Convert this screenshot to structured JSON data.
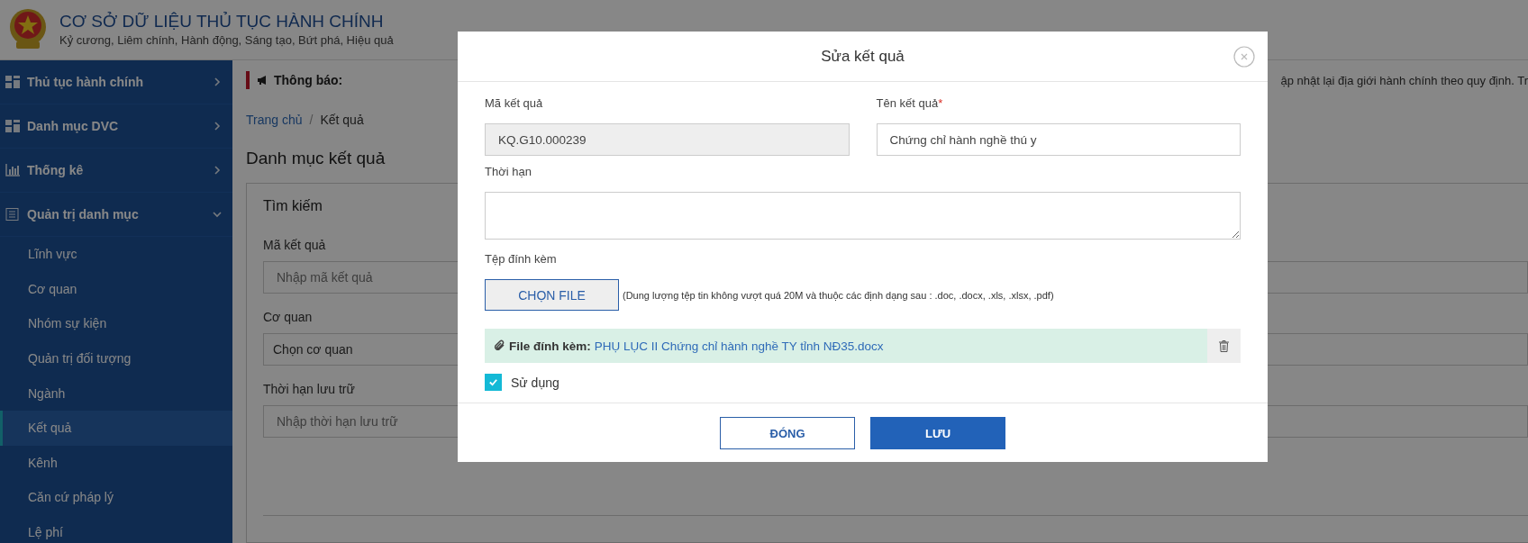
{
  "header": {
    "title": "CƠ SỞ DỮ LIỆU THỦ TỤC HÀNH CHÍNH",
    "slogan": "Kỷ cương, Liêm chính, Hành động, Sáng tạo, Bứt phá, Hiệu quả"
  },
  "sidebar": {
    "items": [
      {
        "label": "Thủ tục hành chính",
        "expanded": false
      },
      {
        "label": "Danh mục DVC",
        "expanded": false
      },
      {
        "label": "Thống kê",
        "expanded": false
      },
      {
        "label": "Quản trị danh mục",
        "expanded": true,
        "children": [
          {
            "label": "Lĩnh vực",
            "selected": false
          },
          {
            "label": "Cơ quan",
            "selected": false
          },
          {
            "label": "Nhóm sự kiện",
            "selected": false
          },
          {
            "label": "Quản trị đối tượng",
            "selected": false
          },
          {
            "label": "Ngành",
            "selected": false
          },
          {
            "label": "Kết quả",
            "selected": true
          },
          {
            "label": "Kênh",
            "selected": false
          },
          {
            "label": "Căn cứ pháp lý",
            "selected": false
          },
          {
            "label": "Lệ phí",
            "selected": false
          }
        ]
      }
    ]
  },
  "notice": {
    "label": "Thông báo:",
    "text": "ập nhật lại địa giới hành chính theo quy định. Tr"
  },
  "breadcrumb": {
    "separator": "/",
    "items": [
      {
        "label": "Trang chủ",
        "kind": "link"
      },
      {
        "label": "Kết quả",
        "kind": "current"
      }
    ]
  },
  "page_title": "Danh mục kết quả",
  "search_panel": {
    "title": "Tìm kiếm",
    "fields": [
      {
        "label": "Mã kết quả",
        "placeholder": "Nhập mã kết quả",
        "kind": "input"
      },
      {
        "label": "Cơ quan",
        "value": "Chọn cơ quan",
        "kind": "select"
      },
      {
        "label": "Thời hạn lưu trữ",
        "placeholder": "Nhập thời hạn lưu trữ",
        "kind": "input"
      }
    ]
  },
  "dialog": {
    "title": "Sửa kết quả",
    "fields": [
      {
        "label": "Mã kết quả",
        "value": "KQ.G10.000239",
        "disabled": true
      },
      {
        "label": "Tên kết quả",
        "required_mark": "*",
        "value": "Chứng chỉ hành nghề thú y",
        "disabled": false
      }
    ],
    "duration": {
      "label": "Thời hạn"
    },
    "attachment": {
      "label": "Tệp đính kèm",
      "button": "CHỌN FILE",
      "hint": "(Dung lượng tệp tin không vượt quá 20M và thuộc các định dạng sau : .doc, .docx, .xls, .xlsx, .pdf)",
      "file_label": "File đính kèm:",
      "file_name": "PHỤ LỤC II Chứng chỉ hành nghề TY tỉnh NĐ35.docx"
    },
    "in_use": {
      "label": "Sử dụng",
      "checked": true
    },
    "buttons": [
      {
        "label": "ĐÓNG",
        "kind": "secondary"
      },
      {
        "label": "LƯU",
        "kind": "primary"
      }
    ]
  }
}
